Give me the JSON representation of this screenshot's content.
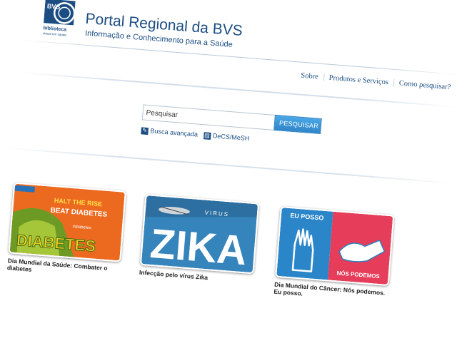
{
  "header": {
    "logo_text_top": "BVS",
    "logo_text_bottom": "biblioteca",
    "logo_text_tiny": "virtual em saúde",
    "title": "Portal Regional da BVS",
    "subtitle": "Informação e Conhecimento para a Saúde"
  },
  "nav": {
    "items": [
      "Sobre",
      "Produtos e Serviços",
      "Como pesquisar?"
    ]
  },
  "search": {
    "input_value": "Pesquisar",
    "button_label": "PESQUISAR",
    "links": [
      "Busca avançada",
      "DeCS/MeSH"
    ]
  },
  "cards": [
    {
      "caption": "Dia Mundial da Saúde: Combater o diabetes",
      "image_text_1": "HALT THE RISE",
      "image_text_2": "BEAT DIABETES",
      "image_text_3": "DIABETES",
      "image_badge": "#diabetes"
    },
    {
      "caption": "Infecção pelo vírus Zika",
      "image_text_1": "VIRUS",
      "image_text_2": "ZIKA"
    },
    {
      "caption": "Dia Mundial do Câncer: Nós podemos. Eu posso.",
      "image_text_1": "EU POSSO",
      "image_text_2": "NÓS PODEMOS"
    }
  ],
  "colors": {
    "brand_blue": "#1b4d83",
    "button_blue": "#3a95d6"
  }
}
